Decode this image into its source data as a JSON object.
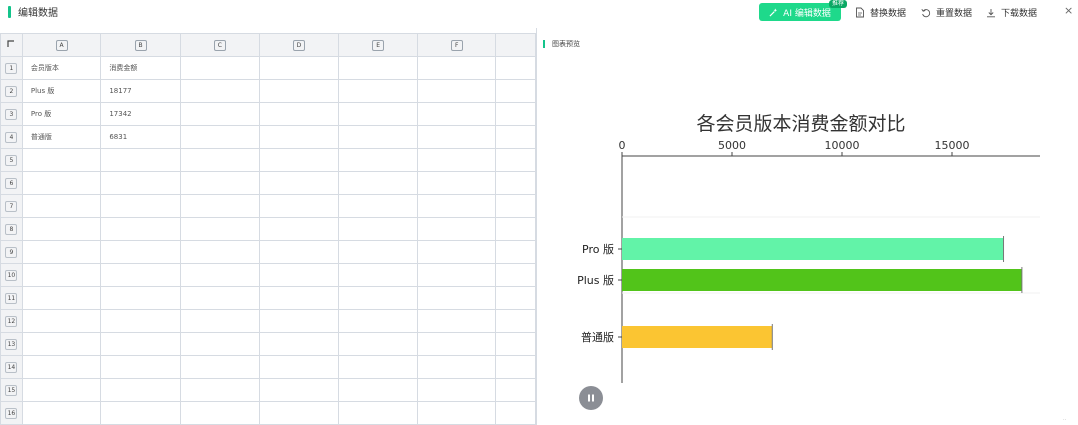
{
  "header": {
    "title": "编辑数据",
    "ai_button": "AI 编辑数据",
    "ai_badge": "推荐",
    "replace": "替换数据",
    "reset": "重置数据",
    "download": "下载数据"
  },
  "sheet": {
    "columns": [
      "A",
      "B",
      "C",
      "D",
      "E",
      "F"
    ],
    "rows": [
      [
        "会员版本",
        "消费金额"
      ],
      [
        "Plus 版",
        "18177"
      ],
      [
        "Pro 版",
        "17342"
      ],
      [
        "普通版",
        "6831"
      ]
    ],
    "row_numbers": [
      "1",
      "2",
      "3",
      "4",
      "5",
      "6",
      "7",
      "8",
      "9",
      "10",
      "11",
      "12",
      "13",
      "14",
      "15",
      "16"
    ]
  },
  "panel": {
    "title": "图表预览"
  },
  "colors": {
    "accent": "#1ed98b",
    "pro": "#62f3a8",
    "plus": "#52c41a",
    "normal": "#fbc532"
  },
  "chart_data": {
    "type": "bar",
    "orientation": "horizontal",
    "title": "各会员版本消费金额对比",
    "categories": [
      "Pro 版",
      "Plus 版",
      "普通版"
    ],
    "values": [
      17342,
      18177,
      6831
    ],
    "colors": [
      "#62f3a8",
      "#52c41a",
      "#fbc532"
    ],
    "xlim": [
      0,
      19000
    ],
    "ticks": [
      0,
      5000,
      10000,
      15000
    ],
    "tick_labels": [
      "0",
      "5000",
      "10000",
      "15000"
    ],
    "axis_position": "top",
    "grid": false,
    "legend": "none"
  },
  "footer": {
    "corner_text": "··"
  }
}
